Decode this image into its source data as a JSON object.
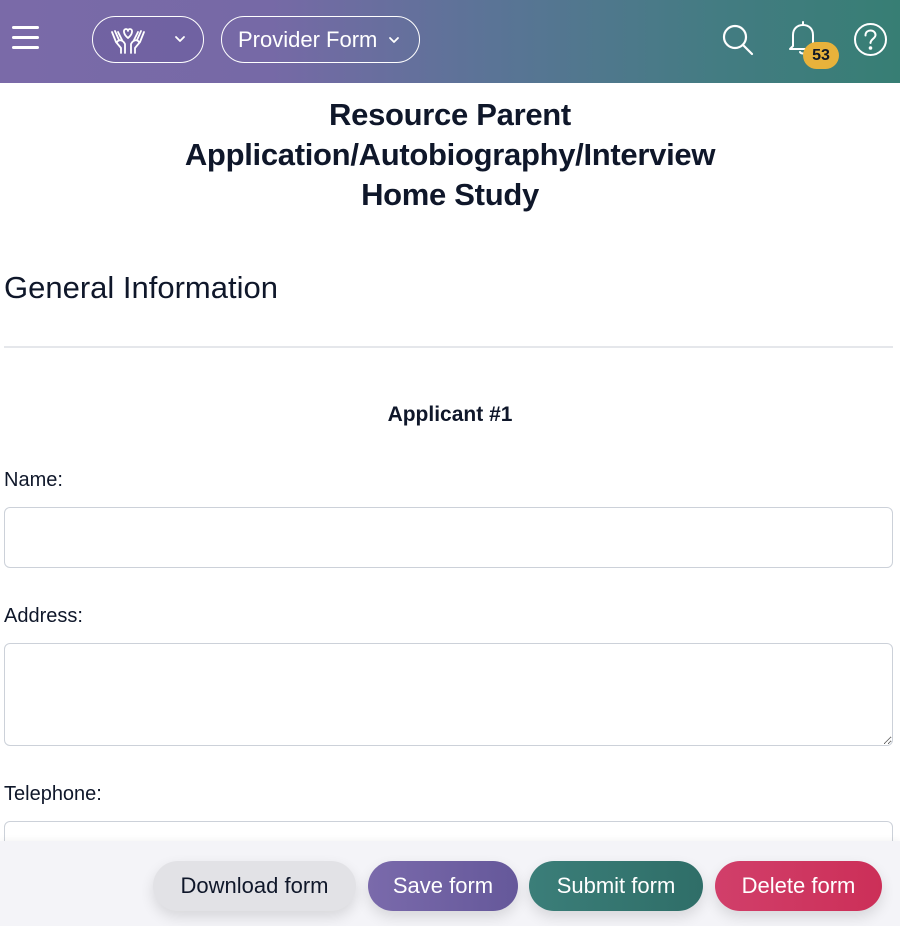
{
  "header": {
    "menu_icon": "hamburger-menu-icon",
    "logo_icon": "hands-heart-icon",
    "form_selector_label": "Provider Form",
    "search_icon": "search-icon",
    "notifications_icon": "bell-icon",
    "notifications_count": "53",
    "help_icon": "help-circle-icon",
    "colors": {
      "gradient_start": "#7a6aa8",
      "gradient_end": "#377e74",
      "badge": "#e8b23b"
    }
  },
  "page": {
    "title_lines": [
      "Resource Parent",
      "Application/Autobiography/Interview",
      "Home Study"
    ],
    "section_title": "General Information",
    "subsection_title": "Applicant #1"
  },
  "form": {
    "fields": [
      {
        "label": "Name:",
        "value": "",
        "type": "text"
      },
      {
        "label": "Address:",
        "value": "",
        "type": "textarea"
      },
      {
        "label": "Telephone:",
        "value": "",
        "type": "text"
      }
    ]
  },
  "actions": {
    "download_label": "Download form",
    "save_label": "Save form",
    "submit_label": "Submit form",
    "delete_label": "Delete form",
    "colors": {
      "download": "#e2e2e6",
      "save": "#7068a4",
      "submit": "#357670",
      "delete": "#ce3761"
    }
  }
}
